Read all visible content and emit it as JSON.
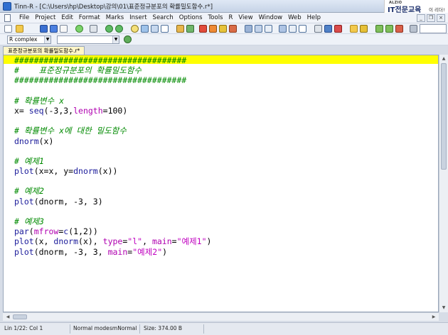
{
  "window": {
    "title": "Tinn-R - [C:\\Users\\hp\\Desktop\\강의\\01\\표준정규분포의 확률밀도함수.r*]"
  },
  "brand": {
    "top": "ALZIO",
    "main": "IT전문교육",
    "sub": "이 리더!"
  },
  "menu": {
    "items": [
      "File",
      "Project",
      "Edit",
      "Format",
      "Marks",
      "Insert",
      "Search",
      "Options",
      "Tools",
      "R",
      "View",
      "Window",
      "Web",
      "Help"
    ]
  },
  "toolbar2": {
    "r_combo_value": "R complex",
    "second_combo_value": ""
  },
  "tab": {
    "label": "표준정규분포의 확률밀도함수.r*"
  },
  "editor": {
    "lines": [
      [
        {
          "t": "###################################",
          "c": "c-comment"
        }
      ],
      [
        {
          "t": "#    표준정규분포의 확률밀도함수",
          "c": "c-comment"
        }
      ],
      [
        {
          "t": "###################################",
          "c": "c-comment"
        }
      ],
      [
        {
          "t": "",
          "c": "c-plain"
        }
      ],
      [
        {
          "t": "# 확률변수 x",
          "c": "c-comment"
        }
      ],
      [
        {
          "t": "x= ",
          "c": "c-plain"
        },
        {
          "t": "seq",
          "c": "c-fn"
        },
        {
          "t": "(-3,3,",
          "c": "c-plain"
        },
        {
          "t": "length",
          "c": "c-kw"
        },
        {
          "t": "=100)",
          "c": "c-plain"
        }
      ],
      [
        {
          "t": "",
          "c": "c-plain"
        }
      ],
      [
        {
          "t": "# 확률변수 x에 대한 밀도함수",
          "c": "c-comment"
        }
      ],
      [
        {
          "t": "dnorm",
          "c": "c-fn"
        },
        {
          "t": "(x)",
          "c": "c-plain"
        }
      ],
      [
        {
          "t": "",
          "c": "c-plain"
        }
      ],
      [
        {
          "t": "# 예제1",
          "c": "c-comment"
        }
      ],
      [
        {
          "t": "plot",
          "c": "c-fn"
        },
        {
          "t": "(x=x, y=",
          "c": "c-plain"
        },
        {
          "t": "dnorm",
          "c": "c-fn"
        },
        {
          "t": "(x))",
          "c": "c-plain"
        }
      ],
      [
        {
          "t": "",
          "c": "c-plain"
        }
      ],
      [
        {
          "t": "# 예제2",
          "c": "c-comment"
        }
      ],
      [
        {
          "t": "plot",
          "c": "c-fn"
        },
        {
          "t": "(dnorm, -3, 3)",
          "c": "c-plain"
        }
      ],
      [
        {
          "t": "",
          "c": "c-plain"
        }
      ],
      [
        {
          "t": "# 예제3",
          "c": "c-comment"
        }
      ],
      [
        {
          "t": "par",
          "c": "c-fn"
        },
        {
          "t": "(",
          "c": "c-plain"
        },
        {
          "t": "mfrow",
          "c": "c-kw"
        },
        {
          "t": "=",
          "c": "c-plain"
        },
        {
          "t": "c",
          "c": "c-fn"
        },
        {
          "t": "(1,2))",
          "c": "c-plain"
        }
      ],
      [
        {
          "t": "plot",
          "c": "c-fn"
        },
        {
          "t": "(x, ",
          "c": "c-plain"
        },
        {
          "t": "dnorm",
          "c": "c-fn"
        },
        {
          "t": "(x), ",
          "c": "c-plain"
        },
        {
          "t": "type",
          "c": "c-kw"
        },
        {
          "t": "=",
          "c": "c-plain"
        },
        {
          "t": "\"l\"",
          "c": "c-str"
        },
        {
          "t": ", ",
          "c": "c-plain"
        },
        {
          "t": "main",
          "c": "c-kw"
        },
        {
          "t": "=",
          "c": "c-plain"
        },
        {
          "t": "\"예제1\"",
          "c": "c-str"
        },
        {
          "t": ")",
          "c": "c-plain"
        }
      ],
      [
        {
          "t": "plot",
          "c": "c-fn"
        },
        {
          "t": "(dnorm, -3, 3, ",
          "c": "c-plain"
        },
        {
          "t": "main",
          "c": "c-kw"
        },
        {
          "t": "=",
          "c": "c-plain"
        },
        {
          "t": "\"예제2\"",
          "c": "c-str"
        },
        {
          "t": ")",
          "c": "c-plain"
        }
      ]
    ]
  },
  "status": {
    "position": "Lin 1/22: Col 1",
    "mode": "Normal mode",
    "syntax": "smNormal",
    "size": "Size: 374.00 B"
  },
  "colors": {
    "highlight": "#ffff00",
    "comment": "#008a00",
    "function": "#1a1a9a",
    "keyword": "#b000b0",
    "string": "#c000c0"
  },
  "icons": [
    "new-file-icon",
    "open-folder-icon",
    "save-icon",
    "save-all-icon",
    "print-icon",
    "undo-icon",
    "redo-icon",
    "find-icon",
    "replace-icon",
    "bookmark-icon",
    "run-icon",
    "send-to-r-icon",
    "filter-icon"
  ]
}
